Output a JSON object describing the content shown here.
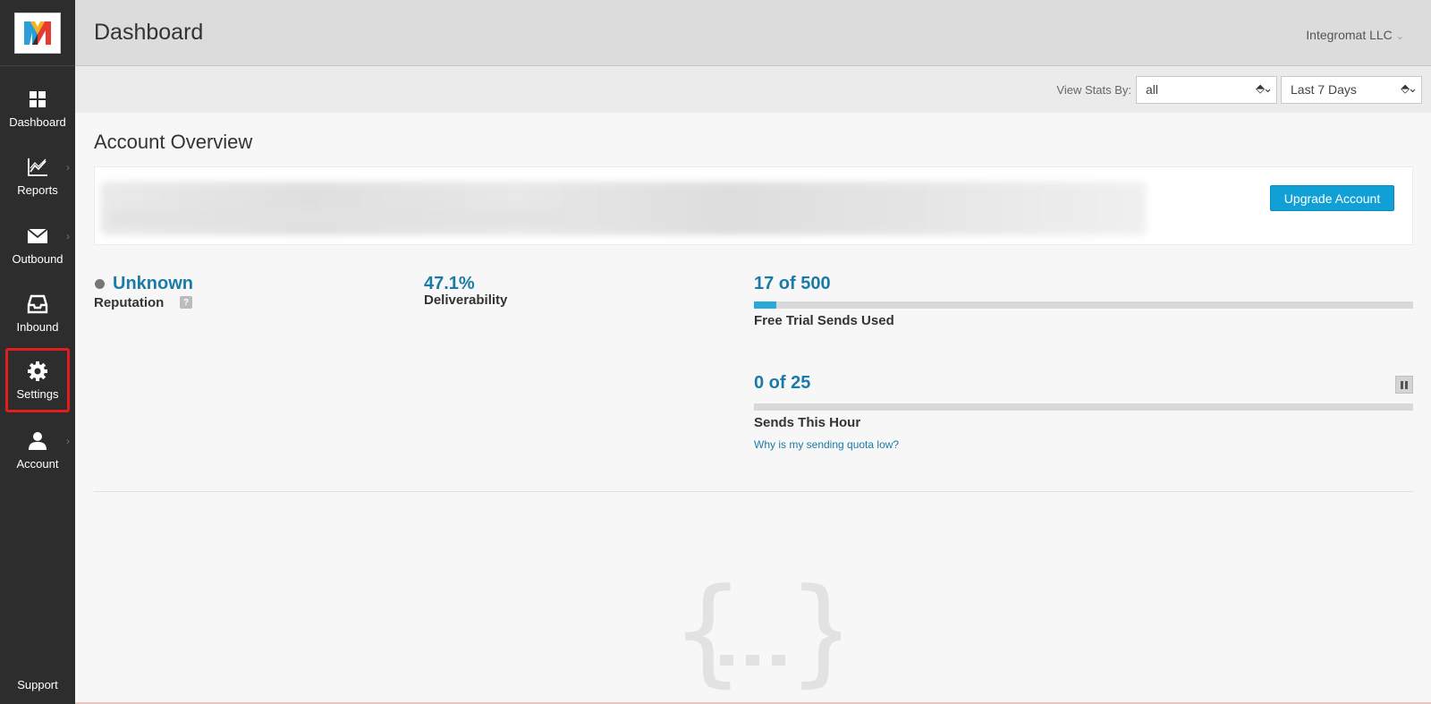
{
  "app": {
    "logo_letter": "M",
    "accent_color": "#11a0d6",
    "link_color": "#1b7ba8"
  },
  "sidebar": {
    "items": [
      {
        "label": "Dashboard",
        "icon": "grid-icon"
      },
      {
        "label": "Reports",
        "icon": "chart-icon"
      },
      {
        "label": "Outbound",
        "icon": "envelope-icon"
      },
      {
        "label": "Inbound",
        "icon": "inbox-icon"
      },
      {
        "label": "Settings",
        "icon": "gear-icon"
      },
      {
        "label": "Account",
        "icon": "user-icon"
      }
    ],
    "support_label": "Support"
  },
  "header": {
    "title": "Dashboard",
    "account_name": "Integromat LLC"
  },
  "filters": {
    "label": "View Stats By:",
    "view_by_value": "all",
    "range_value": "Last 7 Days"
  },
  "overview": {
    "title": "Account Overview",
    "upgrade_label": "Upgrade Account",
    "reputation": {
      "value": "Unknown",
      "label": "Reputation",
      "help": "?"
    },
    "deliverability": {
      "value": "47.1%",
      "label": "Deliverability"
    },
    "trial_sends": {
      "value": "17 of 500",
      "label": "Free Trial Sends Used",
      "used": 17,
      "total": 500
    },
    "hourly_sends": {
      "value": "0 of 25",
      "label": "Sends This Hour",
      "used": 0,
      "total": 25
    },
    "quota_link": "Why is my sending quota low?"
  }
}
